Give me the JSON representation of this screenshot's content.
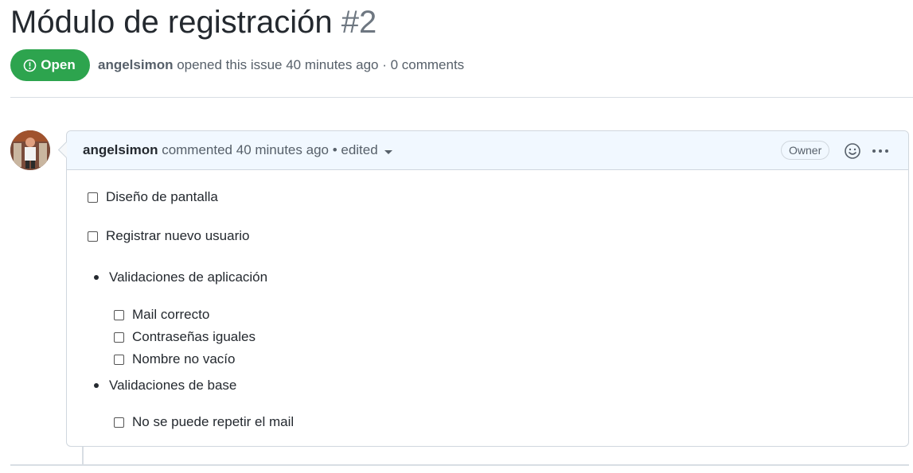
{
  "issue": {
    "title": "Módulo de registración",
    "number": "#2",
    "state_label": "Open",
    "author": "angelsimon",
    "meta_text": " opened this issue 40 minutes ago · 0 comments"
  },
  "comment": {
    "author": "angelsimon",
    "header_text": " commented 40 minutes ago • edited",
    "owner_badge": "Owner",
    "icons": [
      "smiley-icon",
      "kebab-icon",
      "caret-down-icon"
    ]
  },
  "body": {
    "tasks_top": [
      {
        "label": "Diseño de pantalla",
        "checked": false
      },
      {
        "label": "Registrar nuevo usuario",
        "checked": false
      }
    ],
    "bullets": [
      {
        "label": "Validaciones de aplicación",
        "tasks": [
          {
            "label": "Mail correcto",
            "checked": false
          },
          {
            "label": "Contraseñas iguales",
            "checked": false
          },
          {
            "label": "Nombre no vacío",
            "checked": false
          }
        ]
      },
      {
        "label": "Validaciones de base",
        "tasks": [
          {
            "label": "No se puede repetir el mail",
            "checked": false
          }
        ]
      }
    ]
  },
  "colors": {
    "open_green": "#2da44e",
    "header_bg": "#f1f8ff",
    "border": "#d0d7de"
  }
}
